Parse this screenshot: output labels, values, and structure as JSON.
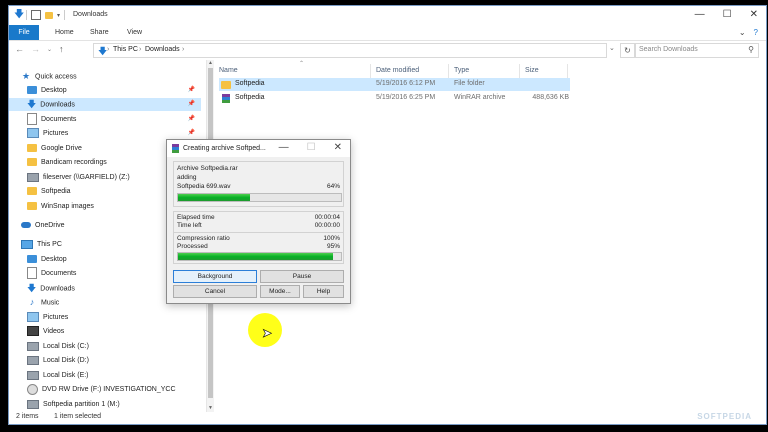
{
  "window": {
    "title": "Downloads",
    "controls": [
      "—",
      "☐",
      "✕"
    ]
  },
  "ribbon": {
    "tabs": [
      "File",
      "Home",
      "Share",
      "View"
    ],
    "right_icons": [
      "chevron-down-icon",
      "help-icon"
    ]
  },
  "address": {
    "path": [
      "This PC",
      "Downloads"
    ],
    "search_placeholder": "Search Downloads"
  },
  "nav": {
    "items": [
      {
        "label": "Quick access",
        "icon": "star-icon"
      },
      {
        "label": "Desktop",
        "icon": "folder-icon",
        "pinned": true
      },
      {
        "label": "Downloads",
        "icon": "download-icon",
        "pinned": true,
        "selected": true
      },
      {
        "label": "Documents",
        "icon": "documents-icon",
        "pinned": true
      },
      {
        "label": "Pictures",
        "icon": "pictures-icon",
        "pinned": true
      },
      {
        "label": "Google Drive",
        "icon": "folder-icon"
      },
      {
        "label": "Bandicam recordings",
        "icon": "folder-icon"
      },
      {
        "label": "fileserver (\\\\GARFIELD) (Z:)",
        "icon": "network-drive-icon"
      },
      {
        "label": "Softpedia",
        "icon": "folder-icon"
      },
      {
        "label": "WinSnap images",
        "icon": "folder-icon"
      },
      {
        "label": "OneDrive",
        "icon": "cloud-icon"
      },
      {
        "label": "This PC",
        "icon": "computer-icon"
      },
      {
        "label": "Desktop",
        "icon": "folder-icon"
      },
      {
        "label": "Documents",
        "icon": "documents-icon"
      },
      {
        "label": "Downloads",
        "icon": "download-icon"
      },
      {
        "label": "Music",
        "icon": "music-icon"
      },
      {
        "label": "Pictures",
        "icon": "pictures-icon"
      },
      {
        "label": "Videos",
        "icon": "videos-icon"
      },
      {
        "label": "Local Disk (C:)",
        "icon": "drive-icon"
      },
      {
        "label": "Local Disk (D:)",
        "icon": "drive-icon"
      },
      {
        "label": "Local Disk (E:)",
        "icon": "drive-icon"
      },
      {
        "label": "DVD RW Drive (F:) INVESTIGATION_YCC",
        "icon": "dvd-drive-icon"
      },
      {
        "label": "Softpedia partition 1 (M:)",
        "icon": "drive-icon"
      }
    ]
  },
  "list": {
    "columns": [
      "Name",
      "Date modified",
      "Type",
      "Size"
    ],
    "rows": [
      {
        "name": "Softpedia",
        "date": "5/19/2016 6:12 PM",
        "type": "File folder",
        "size": "",
        "icon": "folder-icon",
        "selected": true
      },
      {
        "name": "Softpedia",
        "date": "5/19/2016 6:25 PM",
        "type": "WinRAR archive",
        "size": "488,636 KB",
        "icon": "rar-archive-icon"
      }
    ]
  },
  "status": {
    "items": "2 items",
    "selected": "1 item selected",
    "watermark": "SOFTPEDIA"
  },
  "dialog": {
    "title": "Creating archive Softped...",
    "archive": "Archive Softpedia.rar",
    "action": "adding",
    "file": "Softpedia 699.wav",
    "file_percent": "64%",
    "file_progress": 0.44,
    "elapsed_label": "Elapsed time",
    "elapsed": "00:00:04",
    "left_label": "Time left",
    "left": "00:00:00",
    "ratio_label": "Compression ratio",
    "ratio": "100%",
    "processed_label": "Processed",
    "processed": "95%",
    "processed_progress": 0.95,
    "buttons": [
      "Background",
      "Pause",
      "Cancel",
      "Mode...",
      "Help"
    ]
  }
}
